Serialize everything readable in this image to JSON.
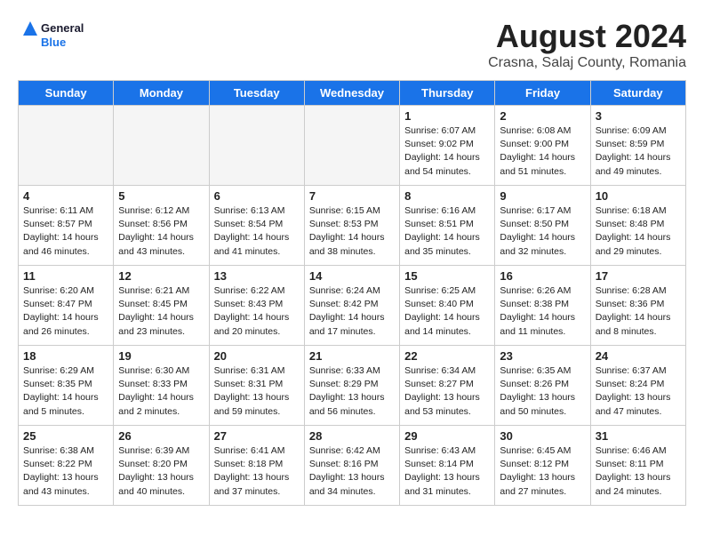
{
  "logo": {
    "line1": "General",
    "line2": "Blue"
  },
  "title": "August 2024",
  "location": "Crasna, Salaj County, Romania",
  "headers": [
    "Sunday",
    "Monday",
    "Tuesday",
    "Wednesday",
    "Thursday",
    "Friday",
    "Saturday"
  ],
  "weeks": [
    [
      {
        "day": "",
        "info": "",
        "empty": true
      },
      {
        "day": "",
        "info": "",
        "empty": true
      },
      {
        "day": "",
        "info": "",
        "empty": true
      },
      {
        "day": "",
        "info": "",
        "empty": true
      },
      {
        "day": "1",
        "info": "Sunrise: 6:07 AM\nSunset: 9:02 PM\nDaylight: 14 hours\nand 54 minutes."
      },
      {
        "day": "2",
        "info": "Sunrise: 6:08 AM\nSunset: 9:00 PM\nDaylight: 14 hours\nand 51 minutes."
      },
      {
        "day": "3",
        "info": "Sunrise: 6:09 AM\nSunset: 8:59 PM\nDaylight: 14 hours\nand 49 minutes."
      }
    ],
    [
      {
        "day": "4",
        "info": "Sunrise: 6:11 AM\nSunset: 8:57 PM\nDaylight: 14 hours\nand 46 minutes."
      },
      {
        "day": "5",
        "info": "Sunrise: 6:12 AM\nSunset: 8:56 PM\nDaylight: 14 hours\nand 43 minutes."
      },
      {
        "day": "6",
        "info": "Sunrise: 6:13 AM\nSunset: 8:54 PM\nDaylight: 14 hours\nand 41 minutes."
      },
      {
        "day": "7",
        "info": "Sunrise: 6:15 AM\nSunset: 8:53 PM\nDaylight: 14 hours\nand 38 minutes."
      },
      {
        "day": "8",
        "info": "Sunrise: 6:16 AM\nSunset: 8:51 PM\nDaylight: 14 hours\nand 35 minutes."
      },
      {
        "day": "9",
        "info": "Sunrise: 6:17 AM\nSunset: 8:50 PM\nDaylight: 14 hours\nand 32 minutes."
      },
      {
        "day": "10",
        "info": "Sunrise: 6:18 AM\nSunset: 8:48 PM\nDaylight: 14 hours\nand 29 minutes."
      }
    ],
    [
      {
        "day": "11",
        "info": "Sunrise: 6:20 AM\nSunset: 8:47 PM\nDaylight: 14 hours\nand 26 minutes."
      },
      {
        "day": "12",
        "info": "Sunrise: 6:21 AM\nSunset: 8:45 PM\nDaylight: 14 hours\nand 23 minutes."
      },
      {
        "day": "13",
        "info": "Sunrise: 6:22 AM\nSunset: 8:43 PM\nDaylight: 14 hours\nand 20 minutes."
      },
      {
        "day": "14",
        "info": "Sunrise: 6:24 AM\nSunset: 8:42 PM\nDaylight: 14 hours\nand 17 minutes."
      },
      {
        "day": "15",
        "info": "Sunrise: 6:25 AM\nSunset: 8:40 PM\nDaylight: 14 hours\nand 14 minutes."
      },
      {
        "day": "16",
        "info": "Sunrise: 6:26 AM\nSunset: 8:38 PM\nDaylight: 14 hours\nand 11 minutes."
      },
      {
        "day": "17",
        "info": "Sunrise: 6:28 AM\nSunset: 8:36 PM\nDaylight: 14 hours\nand 8 minutes."
      }
    ],
    [
      {
        "day": "18",
        "info": "Sunrise: 6:29 AM\nSunset: 8:35 PM\nDaylight: 14 hours\nand 5 minutes."
      },
      {
        "day": "19",
        "info": "Sunrise: 6:30 AM\nSunset: 8:33 PM\nDaylight: 14 hours\nand 2 minutes."
      },
      {
        "day": "20",
        "info": "Sunrise: 6:31 AM\nSunset: 8:31 PM\nDaylight: 13 hours\nand 59 minutes."
      },
      {
        "day": "21",
        "info": "Sunrise: 6:33 AM\nSunset: 8:29 PM\nDaylight: 13 hours\nand 56 minutes."
      },
      {
        "day": "22",
        "info": "Sunrise: 6:34 AM\nSunset: 8:27 PM\nDaylight: 13 hours\nand 53 minutes."
      },
      {
        "day": "23",
        "info": "Sunrise: 6:35 AM\nSunset: 8:26 PM\nDaylight: 13 hours\nand 50 minutes."
      },
      {
        "day": "24",
        "info": "Sunrise: 6:37 AM\nSunset: 8:24 PM\nDaylight: 13 hours\nand 47 minutes."
      }
    ],
    [
      {
        "day": "25",
        "info": "Sunrise: 6:38 AM\nSunset: 8:22 PM\nDaylight: 13 hours\nand 43 minutes."
      },
      {
        "day": "26",
        "info": "Sunrise: 6:39 AM\nSunset: 8:20 PM\nDaylight: 13 hours\nand 40 minutes."
      },
      {
        "day": "27",
        "info": "Sunrise: 6:41 AM\nSunset: 8:18 PM\nDaylight: 13 hours\nand 37 minutes."
      },
      {
        "day": "28",
        "info": "Sunrise: 6:42 AM\nSunset: 8:16 PM\nDaylight: 13 hours\nand 34 minutes."
      },
      {
        "day": "29",
        "info": "Sunrise: 6:43 AM\nSunset: 8:14 PM\nDaylight: 13 hours\nand 31 minutes."
      },
      {
        "day": "30",
        "info": "Sunrise: 6:45 AM\nSunset: 8:12 PM\nDaylight: 13 hours\nand 27 minutes."
      },
      {
        "day": "31",
        "info": "Sunrise: 6:46 AM\nSunset: 8:11 PM\nDaylight: 13 hours\nand 24 minutes."
      }
    ]
  ]
}
